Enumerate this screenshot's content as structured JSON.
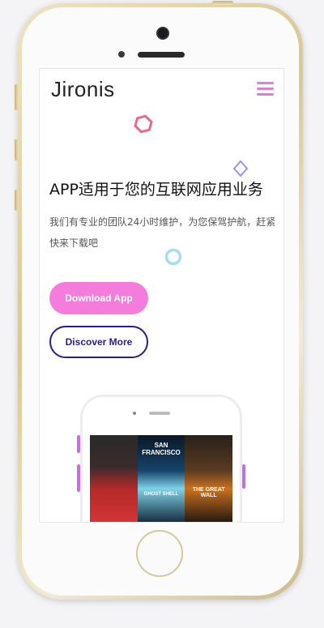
{
  "app": {
    "logo_text": "Jironis"
  },
  "hero": {
    "headline": "APP适用于您的互联网应用业务",
    "subtext": "我们有专业的团队24小时维护，为您保驾护航，赶紧快来下载吧",
    "primary_button_label": "Download App",
    "secondary_button_label": "Discover More"
  },
  "posters": [
    {
      "title": "",
      "tagline": ""
    },
    {
      "title": "SAN FRANCISCO",
      "tagline": "GHOST SHELL"
    },
    {
      "title": "THE GREAT WALL",
      "tagline": ""
    }
  ],
  "colors": {
    "accent_pink": "#f47ddc",
    "accent_navy": "#2c1e86",
    "menu_icon": "#e37cd6",
    "phone_gold": "#d9c795"
  },
  "icons": {
    "menu": "hamburger-icon",
    "deco_hexagon": "hexagon-icon",
    "deco_diamond": "diamond-icon",
    "deco_ring": "ring-icon"
  }
}
